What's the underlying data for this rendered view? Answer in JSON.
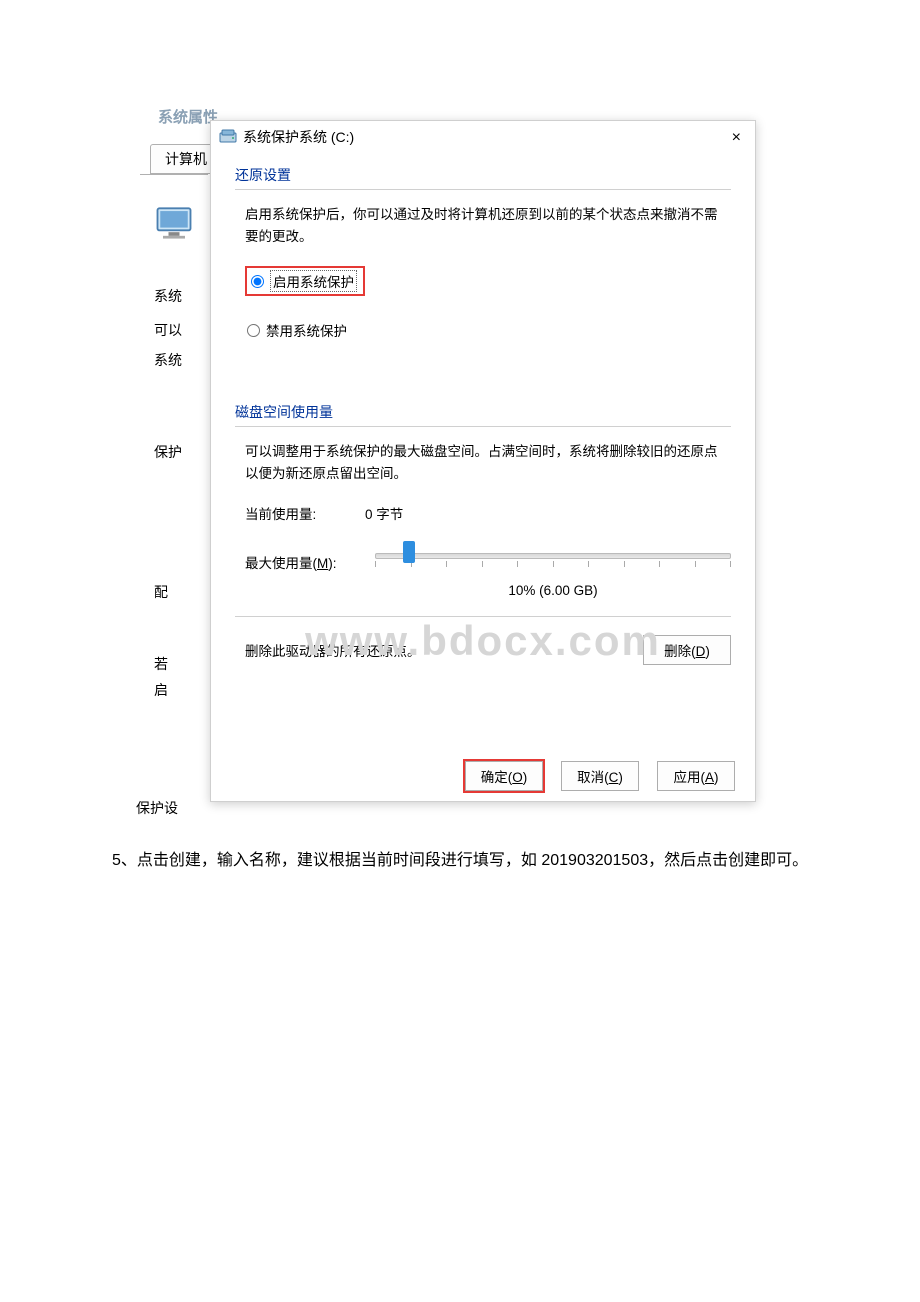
{
  "back_dialog": {
    "title": "系统属性",
    "tab": "计算机",
    "side": {
      "sys": "系统",
      "keyi": "可以",
      "xitong": "系统",
      "baohu": "保护",
      "ke": "可",
      "pei": "配",
      "ruo": "若",
      "qi": "启"
    },
    "footer": "保护设"
  },
  "front_dialog": {
    "title": "系统保护系统 (C:)",
    "close": "×",
    "restore": {
      "heading": "还原设置",
      "desc": "启用系统保护后，你可以通过及时将计算机还原到以前的某个状态点来撤消不需要的更改。",
      "enable_label": "启用系统保护",
      "disable_label": "禁用系统保护"
    },
    "disk": {
      "heading": "磁盘空间使用量",
      "desc": "可以调整用于系统保护的最大磁盘空间。占满空间时，系统将删除较旧的还原点以便为新还原点留出空间。",
      "current_label": "当前使用量:",
      "current_value": "0 字节",
      "max_label_pre": "最大使用量(",
      "max_label_accel": "M",
      "max_label_post": "):",
      "max_value": "10% (6.00 GB)"
    },
    "delete": {
      "desc": "删除此驱动器的所有还原点。",
      "button_pre": "删除(",
      "button_accel": "D",
      "button_post": ")"
    },
    "buttons": {
      "ok_pre": "确定(",
      "ok_accel": "O",
      "ok_post": ")",
      "cancel_pre": "取消(",
      "cancel_accel": "C",
      "cancel_post": ")",
      "apply_pre": "应用(",
      "apply_accel": "A",
      "apply_post": ")"
    }
  },
  "watermark": "www.bdocx.com",
  "caption": {
    "line": "5、点击创建，输入名称，建议根据当前时间段进行填写，如 201903201503，然后点击创建即可。"
  }
}
